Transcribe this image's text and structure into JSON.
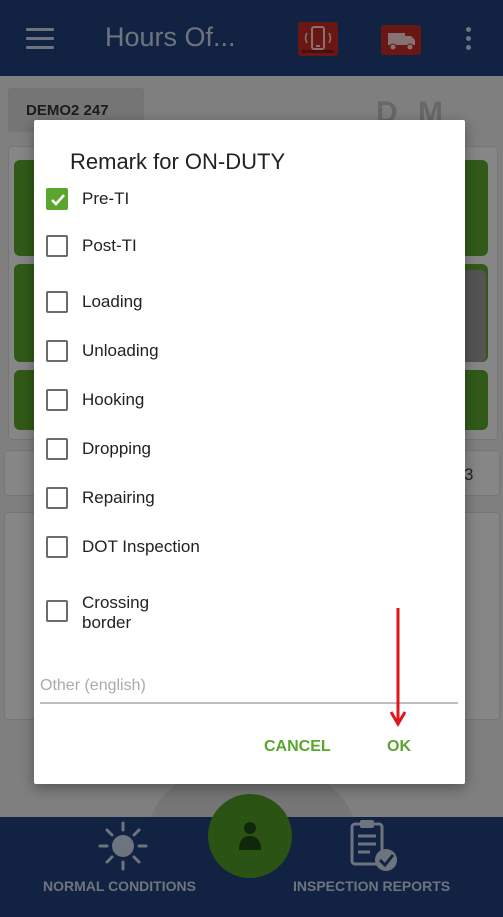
{
  "app_bar": {
    "title": "Hours Of...",
    "menu_icon": "menu-icon",
    "phone_icon": "phone-alert-icon",
    "truck_icon": "truck-icon",
    "more_icon": "more-vert-icon",
    "alert_color": "#c22b25"
  },
  "background": {
    "vehicle": "DEMO2 247",
    "dm": "D M",
    "side_number": "3"
  },
  "dialog": {
    "title": "Remark for ON-DUTY",
    "options": [
      {
        "label": "Pre-TI",
        "checked": true
      },
      {
        "label": "Post-TI",
        "checked": false
      },
      {
        "label": "Loading",
        "checked": false
      },
      {
        "label": "Unloading",
        "checked": false
      },
      {
        "label": "Hooking",
        "checked": false
      },
      {
        "label": "Dropping",
        "checked": false
      },
      {
        "label": "Repairing",
        "checked": false
      },
      {
        "label": "DOT Inspection",
        "checked": false
      },
      {
        "label": "Crossing\nborder",
        "checked": false
      }
    ],
    "other_placeholder": "Other (english)",
    "other_value": "",
    "cancel": "CANCEL",
    "ok": "OK",
    "accent": "#5aa52d"
  },
  "bottom_nav": {
    "left_label": "NORMAL CONDITIONS",
    "right_label": "INSPECTION REPORTS",
    "left_icon": "sun-icon",
    "right_icon": "clipboard-check-icon",
    "bar_color": "#1f3f7a"
  },
  "annotation": {
    "arrow_color": "#e0161b"
  }
}
